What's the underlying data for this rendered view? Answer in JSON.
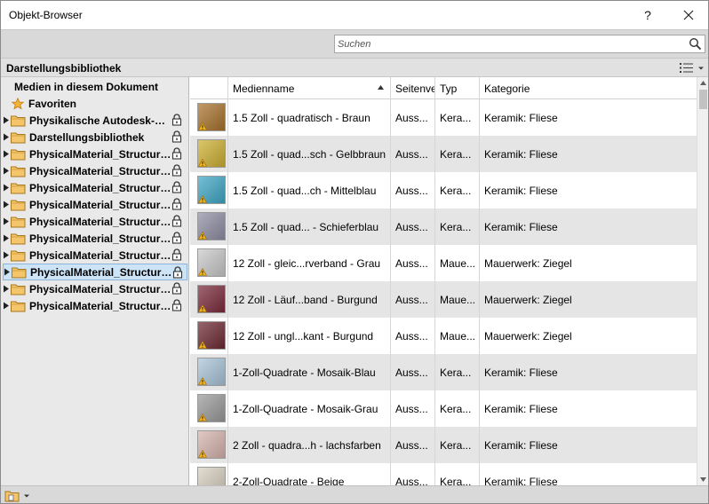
{
  "window": {
    "title": "Objekt-Browser",
    "help_label": "?",
    "close_label": "✕"
  },
  "search": {
    "placeholder": "Suchen",
    "value": ""
  },
  "library": {
    "title": "Darstellungsbibliothek",
    "view_icon": "list-view-icon"
  },
  "tree": {
    "root_label": "Medien in diesem Dokument",
    "favorites_label": "Favoriten",
    "items": [
      {
        "label": "Physikalische Autodesk-O...",
        "selected": false
      },
      {
        "label": "Darstellungsbibliothek",
        "selected": false
      },
      {
        "label": "PhysicalMaterial_Structura...",
        "selected": false
      },
      {
        "label": "PhysicalMaterial_Structura...",
        "selected": false
      },
      {
        "label": "PhysicalMaterial_Structura...",
        "selected": false
      },
      {
        "label": "PhysicalMaterial_Structura...",
        "selected": false
      },
      {
        "label": "PhysicalMaterial_Structura...",
        "selected": false
      },
      {
        "label": "PhysicalMaterial_Structura...",
        "selected": false
      },
      {
        "label": "PhysicalMaterial_Structura...",
        "selected": false
      },
      {
        "label": "PhysicalMaterial_Structura...",
        "selected": true
      },
      {
        "label": "PhysicalMaterial_Structura...",
        "selected": false
      },
      {
        "label": "PhysicalMaterial_Structura...",
        "selected": false
      }
    ]
  },
  "table": {
    "columns": [
      "Medienname",
      "Seitenve",
      "Typ",
      "Kategorie"
    ],
    "sort_column": "Medienname",
    "sort_direction": "ascending",
    "rows": [
      {
        "name": "1.5 Zoll - quadratisch - Braun",
        "side": "Auss...",
        "type": "Kera...",
        "category": "Keramik: Fliese",
        "swatch": "#a8732d"
      },
      {
        "name": "1.5 Zoll - quad...sch - Gelbbraun",
        "side": "Auss...",
        "type": "Kera...",
        "category": "Keramik: Fliese",
        "swatch": "#cdb033"
      },
      {
        "name": "1.5 Zoll - quad...ch - Mittelblau",
        "side": "Auss...",
        "type": "Kera...",
        "category": "Keramik: Fliese",
        "swatch": "#3fa7c5"
      },
      {
        "name": "1.5 Zoll - quad... - Schieferblau",
        "side": "Auss...",
        "type": "Kera...",
        "category": "Keramik: Fliese",
        "swatch": "#8e8ea4"
      },
      {
        "name": "12 Zoll - gleic...rverband - Grau",
        "side": "Auss...",
        "type": "Maue...",
        "category": "Mauerwerk: Ziegel",
        "swatch": "#c9c9c9"
      },
      {
        "name": "12 Zoll - Läuf...band - Burgund",
        "side": "Auss...",
        "type": "Maue...",
        "category": "Mauerwerk: Ziegel",
        "swatch": "#7a2b3b"
      },
      {
        "name": "12 Zoll - ungl...kant - Burgund",
        "side": "Auss...",
        "type": "Maue...",
        "category": "Mauerwerk: Ziegel",
        "swatch": "#6d2a34"
      },
      {
        "name": "1-Zoll-Quadrate - Mosaik-Blau",
        "side": "Auss...",
        "type": "Kera...",
        "category": "Keramik: Fliese",
        "swatch": "#a9c4d8"
      },
      {
        "name": "1-Zoll-Quadrate - Mosaik-Grau",
        "side": "Auss...",
        "type": "Kera...",
        "category": "Keramik: Fliese",
        "swatch": "#9a9a9a"
      },
      {
        "name": "2 Zoll - quadra...h - lachsfarben",
        "side": "Auss...",
        "type": "Kera...",
        "category": "Keramik: Fliese",
        "swatch": "#d6b4ad"
      },
      {
        "name": "2-Zoll-Quadrate - Beige",
        "side": "Auss...",
        "type": "Kera...",
        "category": "Keramik: Fliese",
        "swatch": "#d7d0c0"
      }
    ]
  },
  "footer": {
    "library_icon": "library-folder-icon"
  }
}
